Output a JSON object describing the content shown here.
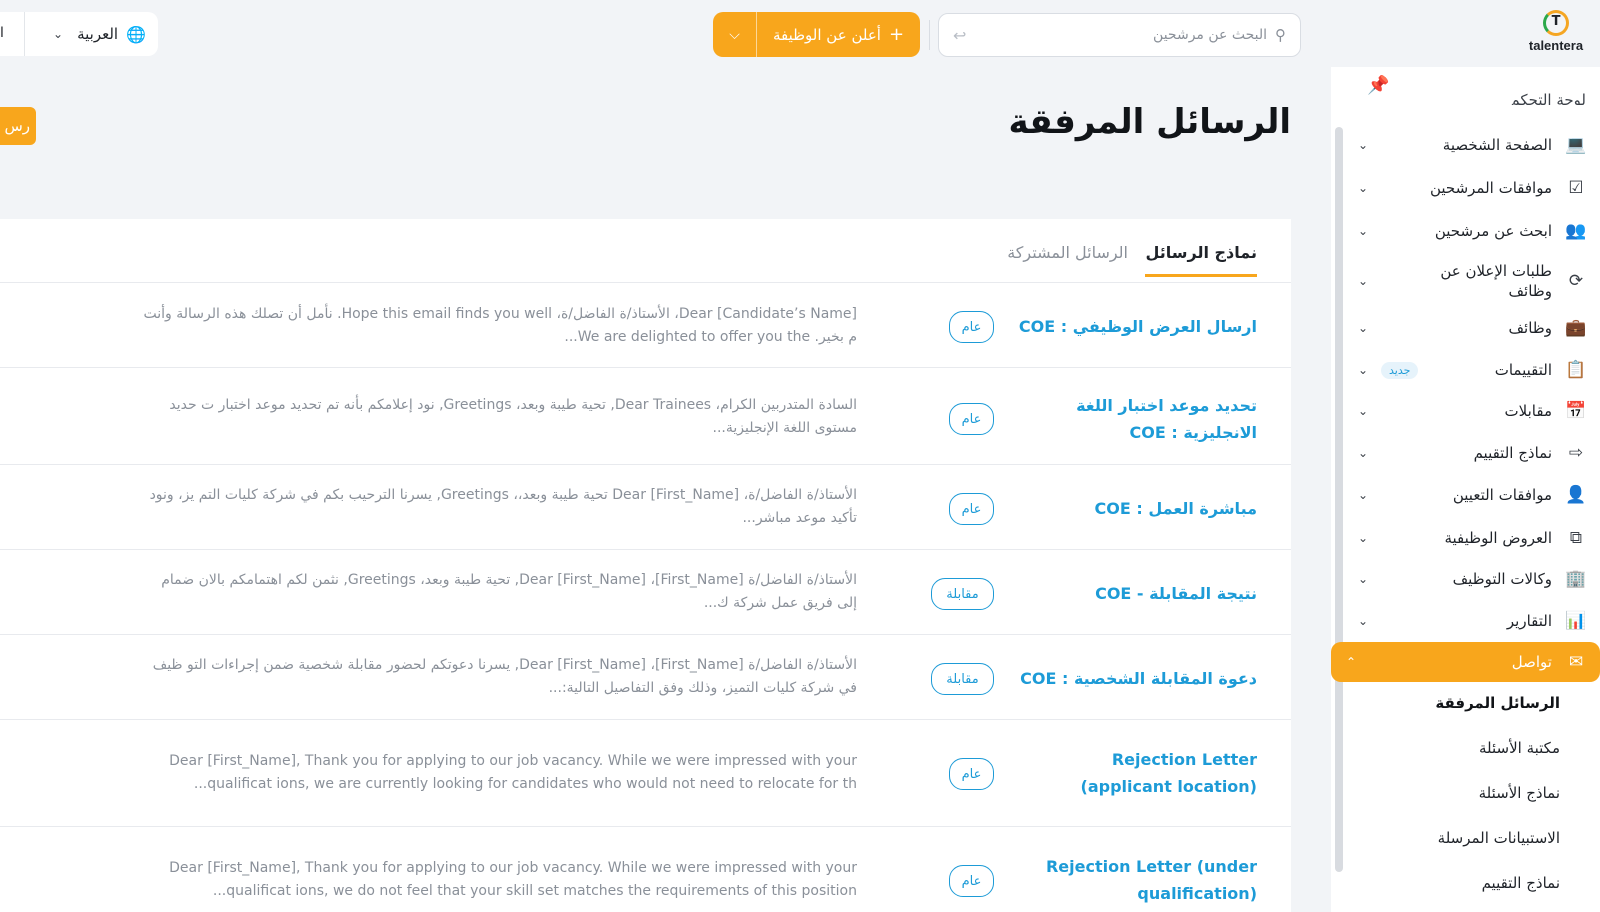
{
  "brand": {
    "name": "talentera",
    "mark": "T",
    "accent": "#f8a61c",
    "link_color": "#1d9bd7"
  },
  "topbar": {
    "search_placeholder": "البحث عن مرشحين",
    "search_icon": "search-icon",
    "enter_icon": "return-arrow-icon",
    "post_job_label": "أعلن عن الوظيفة",
    "post_job_plus": "+",
    "post_job_chevron": "⌄",
    "language_label": "العربية",
    "language_cut_text": "ا"
  },
  "page": {
    "title": "الرسائل المرفقة",
    "cta_cut_label": "رس"
  },
  "tabs": [
    {
      "label": "نماذج الرسائل",
      "active": true
    },
    {
      "label": "الرسائل المشتركة",
      "active": false
    }
  ],
  "templates": [
    {
      "name": "ارسال العرض الوظيفي : COE",
      "tag": "عام",
      "preview": "Dear [Candidate’s Name]، الأستاذ/ة الفاضل/ة، Hope this email finds you well. نأمل أن تصلك هذه الرسالة وأنت م بخير. We are delighted to offer you the..."
    },
    {
      "name": "تحديد موعد اختبار اللغة الانجليزية : COE",
      "tag": "عام",
      "preview": "السادة المتدربين الكرام،    Dear Trainees, تحية طيبة وبعد، Greetings, نود إعلامكم بأنه تم تحديد موعد اختبار ت حديد مستوى اللغة الإنجليزية..."
    },
    {
      "name": "مباشرة العمل : COE",
      "tag": "عام",
      "preview": "الأستاذ/ة الفاضل/ة،    Dear [First_Name] تحية طيبة وبعد،،    Greetings, يسرنا الترحيب بكم في شركة كليات التم يز، ونود تأكيد موعد مباشر..."
    },
    {
      "name": "نتيجة المقابلة - COE",
      "tag": "مقابلة",
      "preview": "الأستاذ/ة الفاضل/ة [First_Name]،    Dear [First_Name], تحية طيبة وبعد،    Greetings, نثمن لكم اهتمامكم بالان ضمام إلى فريق عمل شركة ك..."
    },
    {
      "name": "دعوة المقابلة الشخصية : COE",
      "tag": "مقابلة",
      "preview": "الأستاذ/ة الفاضل/ة [First_Name]،    Dear [First_Name], يسرنا دعوتكم لحضور مقابلة شخصية ضمن إجراءات التو ظيف في شركة كليات التميز، وذلك وفق التفاصيل التالية:..."
    },
    {
      "name": "Rejection Letter (applicant location)",
      "tag": "عام",
      "preview": "Dear [First_Name], Thank you for applying to our job vacancy. While we were impressed with your qualificat ions, we are currently looking for candidates who would not need to relocate for th..."
    },
    {
      "name": "Rejection Letter (under qualification)",
      "tag": "عام",
      "preview": "Dear [First_Name], Thank you for applying to our job vacancy. While we were impressed with your qualificat ions, we do not feel that your skill set matches the requirements of this position..."
    }
  ],
  "sidebar": {
    "clipped_top_label": "لوحة التحكم",
    "pin_icon": "pin-icon",
    "items": [
      {
        "label": "الصفحة الشخصية",
        "icon": "laptop-icon"
      },
      {
        "label": "موافقات المرشحين",
        "icon": "checklist-icon"
      },
      {
        "label": "ابحث عن مرشحين",
        "icon": "users-search-icon"
      },
      {
        "label": "طلبات الإعلان عن وظائف",
        "icon": "refresh-icon"
      },
      {
        "label": "وظائف",
        "icon": "briefcase-icon"
      },
      {
        "label": "التقييمات",
        "icon": "assessment-icon",
        "badge": "جديد"
      },
      {
        "label": "مقابلات",
        "icon": "calendar-icon"
      },
      {
        "label": "نماذج التقييم",
        "icon": "form-enter-icon"
      },
      {
        "label": "موافقات التعيين",
        "icon": "user-add-icon"
      },
      {
        "label": "العروض الوظيفية",
        "icon": "copy-icon"
      },
      {
        "label": "وكالات التوظيف",
        "icon": "building-icon"
      },
      {
        "label": "التقارير",
        "icon": "bar-chart-icon"
      },
      {
        "label": "تواصل",
        "icon": "mail-icon",
        "active": true
      }
    ],
    "sub_items": [
      {
        "label": "الرسائل المرفقة",
        "selected": true
      },
      {
        "label": "مكتبة الأسئلة"
      },
      {
        "label": "نماذج الأسئلة"
      },
      {
        "label": "الاستبيانات المرسلة"
      },
      {
        "label": "نماذج التقييم"
      }
    ]
  }
}
